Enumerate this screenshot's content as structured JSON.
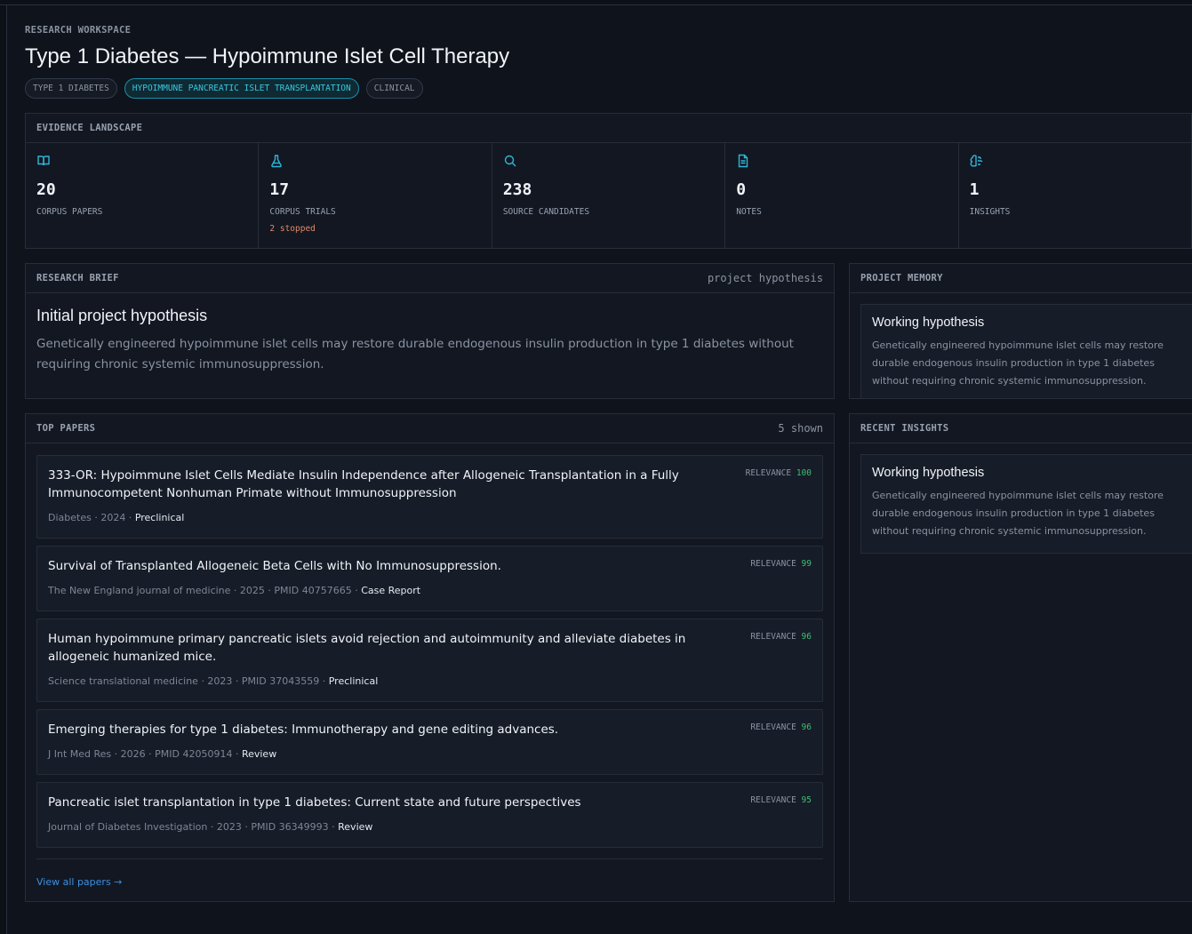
{
  "header": {
    "eyebrow": "RESEARCH WORKSPACE",
    "title": "Type 1 Diabetes — Hypoimmune Islet Cell Therapy",
    "tags": [
      "TYPE 1 DIABETES",
      "HYPOIMMUNE PANCREATIC ISLET TRANSPLANTATION",
      "CLINICAL"
    ]
  },
  "evidence": {
    "title": "EVIDENCE LANDSCAPE",
    "stats": [
      {
        "icon": "book-open-icon",
        "value": "20",
        "label": "CORPUS PAPERS",
        "sub": ""
      },
      {
        "icon": "flask-icon",
        "value": "17",
        "label": "CORPUS TRIALS",
        "sub": "2 stopped"
      },
      {
        "icon": "search-icon",
        "value": "238",
        "label": "SOURCE CANDIDATES",
        "sub": ""
      },
      {
        "icon": "document-icon",
        "value": "0",
        "label": "NOTES",
        "sub": ""
      },
      {
        "icon": "brain-icon",
        "value": "1",
        "label": "INSIGHTS",
        "sub": ""
      }
    ]
  },
  "brief": {
    "title": "RESEARCH BRIEF",
    "meta": "project hypothesis",
    "heading": "Initial project hypothesis",
    "text": "Genetically engineered hypoimmune islet cells may restore durable endogenous insulin production in type 1 diabetes without requiring chronic systemic immunosuppression."
  },
  "memory": {
    "title": "PROJECT MEMORY",
    "card_title": "Working hypothesis",
    "card_text": "Genetically engineered hypoimmune islet cells may restore durable endogenous insulin production in type 1 diabetes without requiring chronic systemic immunosuppression."
  },
  "papers": {
    "title": "TOP PAPERS",
    "meta": "5 shown",
    "relevance_label": "RELEVANCE",
    "items": [
      {
        "title": "333-OR: Hypoimmune Islet Cells Mediate Insulin Independence after Allogeneic Transplantation in a Fully Immunocompetent Nonhuman Primate without Immunosuppression",
        "meta": "Diabetes · 2024 · ",
        "type": "Preclinical",
        "relevance": "100"
      },
      {
        "title": "Survival of Transplanted Allogeneic Beta Cells with No Immunosuppression.",
        "meta": "The New England journal of medicine · 2025 · PMID 40757665 · ",
        "type": "Case Report",
        "relevance": "99"
      },
      {
        "title": "Human hypoimmune primary pancreatic islets avoid rejection and autoimmunity and alleviate diabetes in allogeneic humanized mice.",
        "meta": "Science translational medicine · 2023 · PMID 37043559 · ",
        "type": "Preclinical",
        "relevance": "96"
      },
      {
        "title": "Emerging therapies for type 1 diabetes: Immunotherapy and gene editing advances.",
        "meta": "J Int Med Res · 2026 · PMID 42050914 · ",
        "type": "Review",
        "relevance": "96"
      },
      {
        "title": "Pancreatic islet transplantation in type 1 diabetes: Current state and future perspectives",
        "meta": "Journal of Diabetes Investigation · 2023 · PMID 36349993 · ",
        "type": "Review",
        "relevance": "95"
      }
    ],
    "view_all": "View all papers →"
  },
  "insights": {
    "title": "RECENT INSIGHTS",
    "card_title": "Working hypothesis",
    "card_text": "Genetically engineered hypoimmune islet cells may restore durable endogenous insulin production in type 1 diabetes without requiring chronic systemic immunosuppression."
  },
  "colors": {
    "background": "#0f131c",
    "accent": "#2fb6d6",
    "relevance": "#3fbf6f",
    "stopped": "#e08a6a",
    "link": "#3d8fe0"
  }
}
